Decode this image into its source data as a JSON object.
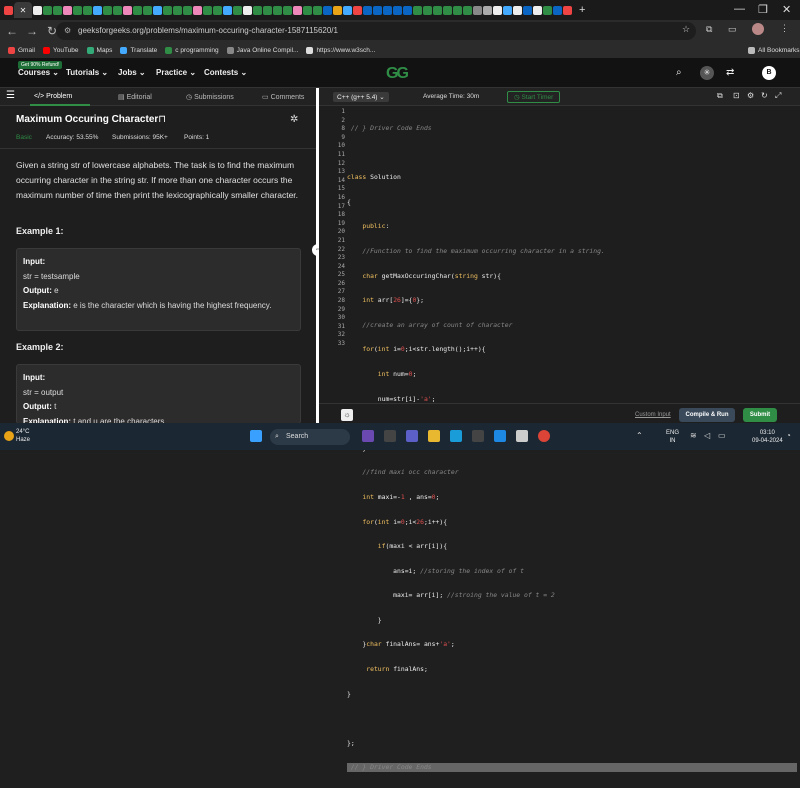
{
  "browser": {
    "url": "geeksforgeeks.org/problems/maximum-occuring-character-1587115620/1",
    "bookmarks": [
      "Gmail",
      "YouTube",
      "Maps",
      "Translate",
      "c programming",
      "Java Online Compil...",
      "https://www.w3sch..."
    ],
    "all_bookmarks": "All Bookmarks"
  },
  "site": {
    "refund_badge": "Get 90% Refund!",
    "nav": [
      "Courses",
      "Tutorials",
      "Jobs",
      "Practice",
      "Contests"
    ],
    "logo": "GG",
    "avatar": "B"
  },
  "left": {
    "tabs": [
      "Problem",
      "Editorial",
      "Submissions",
      "Comments"
    ],
    "title": "Maximum Occuring Character",
    "difficulty": "Basic",
    "accuracy": "Accuracy: 53.55%",
    "submissions": "Submissions: 95K+",
    "points": "Points: 1",
    "description": "Given a string str of lowercase alphabets. The task is to find the maximum occurring character in the string str. If more than one character occurs the maximum number of time then print the lexicographically smaller character.",
    "examples": [
      {
        "title": "Example 1:",
        "input_label": "Input:",
        "input": "str = testsample",
        "output_label": "Output:",
        "output": "e",
        "explanation_label": "Explanation:",
        "explanation": "e is the character which is having the highest frequency."
      },
      {
        "title": "Example 2:",
        "input_label": "Input:",
        "input": "str = output",
        "output_label": "Output:",
        "output": "t",
        "explanation_label": "Explanation:",
        "explanation": "t and u are the characters"
      }
    ]
  },
  "editor": {
    "language": "C++ (g++ 5.4)",
    "avg_time": "Average Time: 30m",
    "timer": "Start Timer",
    "line_numbers": [
      "1",
      "2",
      "8",
      "9",
      "10",
      "11",
      "12",
      "13",
      "14",
      "15",
      "16",
      "17",
      "18",
      "19",
      "20",
      "21",
      "22",
      "23",
      "24",
      "25",
      "26",
      "27",
      "28",
      "29",
      "30",
      "31",
      "32",
      "33"
    ],
    "custom_input": "Custom Input",
    "compile_run": "Compile & Run",
    "submit": "Submit"
  },
  "taskbar": {
    "weather_temp": "24°C",
    "weather_desc": "Haze",
    "search": "Search",
    "lang1": "ENG",
    "lang2": "IN",
    "time": "03:10",
    "date": "09-04-2024"
  }
}
